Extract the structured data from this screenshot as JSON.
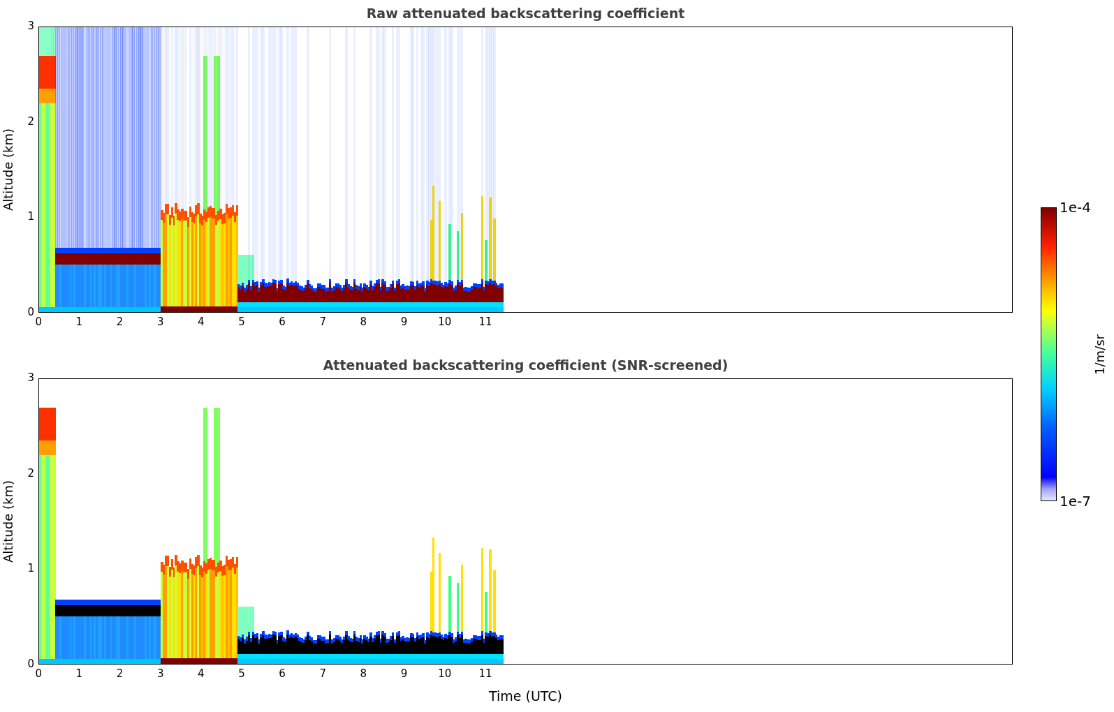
{
  "panels": [
    {
      "kind": "raw",
      "title": "Raw attenuated backscattering coefficient",
      "ylabel": "Altitude (km)",
      "yticks": [
        "3",
        "2",
        "1",
        "0"
      ],
      "xticks": [
        "0",
        "1",
        "2",
        "3",
        "4",
        "5",
        "6",
        "7",
        "8",
        "9",
        "10",
        "11"
      ]
    },
    {
      "kind": "screened",
      "title": "Attenuated backscattering coefficient (SNR-screened)",
      "ylabel": "Altitude (km)",
      "yticks": [
        "3",
        "2",
        "1",
        "0"
      ],
      "xticks": [
        "0",
        "1",
        "2",
        "3",
        "4",
        "5",
        "6",
        "7",
        "8",
        "9",
        "10",
        "11"
      ],
      "xlabel": "Time (UTC)"
    }
  ],
  "colorbar": {
    "max": "1e-4",
    "min": "1e-7",
    "label": "1/m/sr"
  }
}
